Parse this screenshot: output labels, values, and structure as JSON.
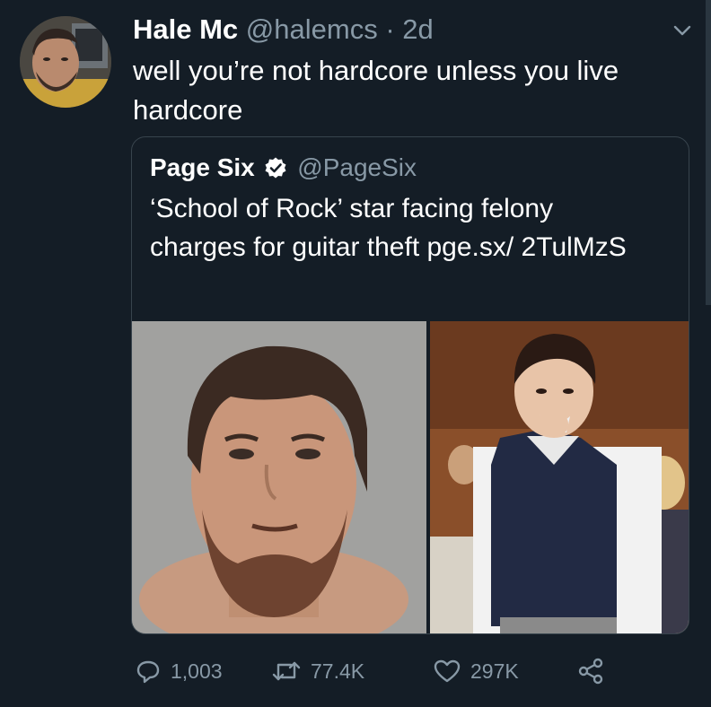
{
  "tweet": {
    "display_name": "Hale Mc",
    "handle": "@halemcs",
    "separator": "·",
    "time": "2d",
    "text": "well you’re not hardcore unless you live hardcore"
  },
  "quoted_tweet": {
    "display_name": "Page Six",
    "handle": "@PageSix",
    "text": "‘School of Rock’ star facing felony charges for guitar theft pge.sx/ 2TulMzS"
  },
  "actions": {
    "replies": "1,003",
    "retweets": "77.4K",
    "likes": "297K"
  },
  "icons": {
    "menu": "chevron-down-icon",
    "verified": "verified-badge-icon",
    "reply": "reply-icon",
    "retweet": "retweet-icon",
    "like": "heart-icon",
    "share": "share-icon"
  },
  "colors": {
    "background": "#141d26",
    "secondary_text": "#8899a6",
    "border": "#38444d",
    "verified": "#ffffff"
  }
}
